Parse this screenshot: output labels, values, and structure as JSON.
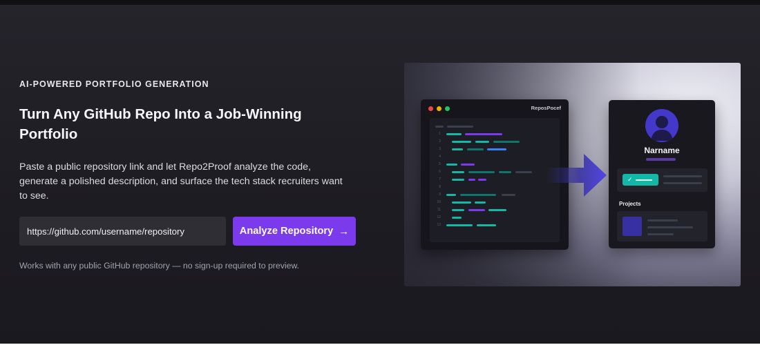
{
  "hero": {
    "eyebrow": "AI-POWERED PORTFOLIO GENERATION",
    "title": "Turn Any GitHub Repo Into a Job-Winning Portfolio",
    "description": "Paste a public repository link and let Repo2Proof analyze the code, generate a polished description, and surface the tech stack recruiters want to see.",
    "input": {
      "value": "https://github.com/username/repository",
      "placeholder": "https://github.com/username/repository"
    },
    "button": {
      "label": "Analyze Repository",
      "icon": "arrow-right-icon",
      "color": "#7c3aed"
    },
    "footnote": "Works with any public GitHub repository — no sign-up required to preview."
  },
  "illustration": {
    "editor": {
      "title": "ReposPocef",
      "line_numbers": [
        "1",
        "2",
        "3",
        "4",
        "5",
        "6",
        "7",
        "8",
        "9",
        "10",
        "11",
        "12",
        "13"
      ]
    },
    "profile": {
      "name": "Narname",
      "projects_label": "Projects"
    },
    "colors": {
      "teal": "#14b8a6",
      "purple": "#7c3aed",
      "indigo": "#4338ca"
    }
  }
}
